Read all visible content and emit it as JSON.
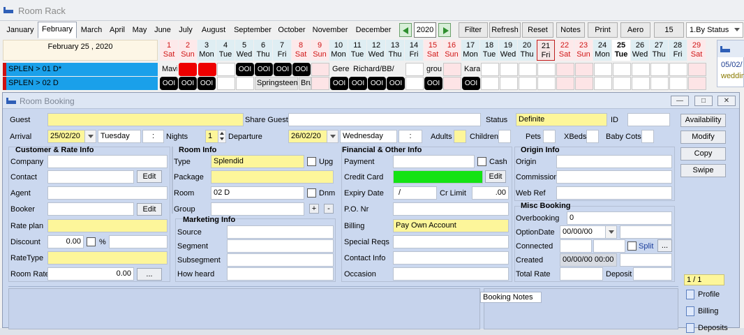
{
  "rack": {
    "title": "Room Rack",
    "months": [
      "January",
      "February",
      "March",
      "April",
      "May",
      "June",
      "July",
      "August",
      "September",
      "October",
      "November",
      "December"
    ],
    "active_month": "February",
    "year": "2020",
    "buttons": [
      "Filter",
      "Refresh",
      "Reset",
      "Notes",
      "Print",
      "Aero",
      "15"
    ],
    "status_select": "1.By Status",
    "current_date": "February  25 , 2020",
    "days": [
      {
        "n": "1",
        "d": "Sat"
      },
      {
        "n": "2",
        "d": "Sun"
      },
      {
        "n": "3",
        "d": "Mon"
      },
      {
        "n": "4",
        "d": "Tue"
      },
      {
        "n": "5",
        "d": "Wed"
      },
      {
        "n": "6",
        "d": "Thu"
      },
      {
        "n": "7",
        "d": "Fri"
      },
      {
        "n": "8",
        "d": "Sat"
      },
      {
        "n": "9",
        "d": "Sun"
      },
      {
        "n": "10",
        "d": "Mon"
      },
      {
        "n": "11",
        "d": "Tue"
      },
      {
        "n": "12",
        "d": "Wed"
      },
      {
        "n": "13",
        "d": "Thu"
      },
      {
        "n": "14",
        "d": "Fri"
      },
      {
        "n": "15",
        "d": "Sat"
      },
      {
        "n": "16",
        "d": "Sun"
      },
      {
        "n": "17",
        "d": "Mon"
      },
      {
        "n": "18",
        "d": "Tue"
      },
      {
        "n": "19",
        "d": "Wed"
      },
      {
        "n": "20",
        "d": "Thu"
      },
      {
        "n": "21",
        "d": "Fri"
      },
      {
        "n": "22",
        "d": "Sat"
      },
      {
        "n": "23",
        "d": "Sun"
      },
      {
        "n": "24",
        "d": "Mon"
      },
      {
        "n": "25",
        "d": "Tue"
      },
      {
        "n": "26",
        "d": "Wed"
      },
      {
        "n": "27",
        "d": "Thu"
      },
      {
        "n": "28",
        "d": "Fri"
      },
      {
        "n": "29",
        "d": "Sat"
      }
    ],
    "rows": [
      {
        "label": "SPLEN > 01 D*",
        "texts": {
          "mavi": "Mavi",
          "gere": "Gere",
          "richard": "Richard/BB/",
          "grou": "grou",
          "kara": "Kara"
        }
      },
      {
        "label": "SPLEN > 02 D",
        "texts": {
          "springsteen": "Springsteen",
          "bru": "Bru"
        }
      }
    ],
    "ooi": "OOI",
    "side_panel": {
      "date": "05/02/",
      "note": "weddin"
    }
  },
  "booking": {
    "title": "Room Booking",
    "window_buttons": [
      "—",
      "□",
      "✕"
    ],
    "guest_label": "Guest",
    "guest": "",
    "share_guest_label": "Share Guest",
    "share_guest": "",
    "status_label": "Status",
    "status": "Definite",
    "id_label": "ID",
    "id": "",
    "arrival_label": "Arrival",
    "arrival": "25/02/20",
    "arrival_day": "Tuesday",
    "arrival_time": ":",
    "nights_label": "Nights",
    "nights": "1",
    "departure_label": "Departure",
    "departure": "26/02/20",
    "departure_day": "Wednesday",
    "departure_time": ":",
    "adults_label": "Adults",
    "adults": "",
    "children_label": "Children",
    "pets_label": "Pets",
    "xbeds_label": "XBeds",
    "babycots_label": "Baby Cots",
    "customer": {
      "header": "Customer & Rate Info",
      "company_label": "Company",
      "contact_label": "Contact",
      "agent_label": "Agent",
      "booker_label": "Booker",
      "rateplan_label": "Rate plan",
      "discount_label": "Discount",
      "discount": "0.00",
      "percent": "%",
      "ratetype_label": "RateType",
      "roomrate_label": "Room Rate",
      "roomrate": "0.00",
      "edit": "Edit",
      "more": "..."
    },
    "room": {
      "header": "Room Info",
      "type_label": "Type",
      "type": "Splendid",
      "upg": "Upg",
      "package_label": "Package",
      "room_label": "Room",
      "room": "02 D",
      "dnm": "Dnm",
      "group_label": "Group",
      "plus": "+",
      "minus": "-"
    },
    "marketing": {
      "header": "Marketing Info",
      "source_label": "Source",
      "segment_label": "Segment",
      "subsegment_label": "Subsegment",
      "howheard_label": "How heard"
    },
    "financial": {
      "header": "Financial & Other Info",
      "payment_label": "Payment",
      "cash": "Cash",
      "creditcard_label": "Credit Card",
      "edit": "Edit",
      "expiry_label": "Expiry Date",
      "expiry": "/",
      "crlimit_label": "Cr Limit",
      "crlimit": ".00",
      "po_label": "P.O. Nr",
      "billing_label": "Billing",
      "billing": "Pay Own Account",
      "special_label": "Special Reqs",
      "contactinfo_label": "Contact Info",
      "occasion_label": "Occasion"
    },
    "origin": {
      "header": "Origin Info",
      "origin_label": "Origin",
      "commission_label": "Commission",
      "webref_label": "Web Ref"
    },
    "misc": {
      "header": "Misc Booking",
      "overbooking_label": "Overbooking",
      "overbooking": "0",
      "optiondate_label": "OptionDate",
      "optiondate": "00/00/00",
      "connected_label": "Connected",
      "split": "Split",
      "more": "...",
      "created_label": "Created",
      "created": "00/00/00 00:00",
      "totalrate_label": "Total Rate",
      "deposit_label": "Deposit"
    },
    "actions": [
      "Availability",
      "Modify",
      "Copy",
      "Swipe"
    ],
    "pager": "1 / 1",
    "booking_notes": "Booking Notes",
    "side_buttons": [
      "Profile",
      "Billing",
      "Deposits"
    ]
  },
  "colors": {
    "required": "#fdf69a",
    "credit_card": "#14e314",
    "room_row": "#1aa0ea",
    "weekend": "#fde9ea"
  }
}
